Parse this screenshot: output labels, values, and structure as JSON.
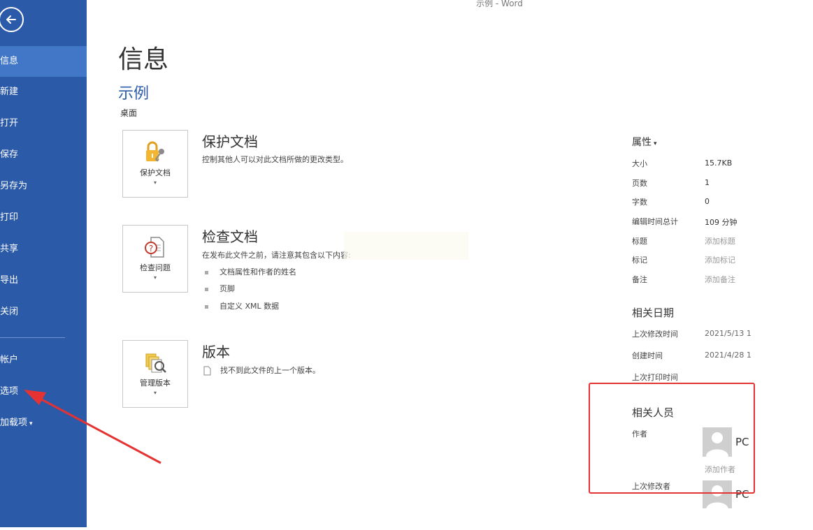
{
  "window": {
    "title": "示例 - Word"
  },
  "sidebar": {
    "items": [
      {
        "label": "信息"
      },
      {
        "label": "新建"
      },
      {
        "label": "打开"
      },
      {
        "label": "保存"
      },
      {
        "label": "另存为"
      },
      {
        "label": "打印"
      },
      {
        "label": "共享"
      },
      {
        "label": "导出"
      },
      {
        "label": "关闭"
      },
      {
        "label": "帐户"
      },
      {
        "label": "选项"
      },
      {
        "label": "加载项"
      }
    ],
    "active_index": 0,
    "accent_color": "#2b5aa8"
  },
  "main": {
    "page_title": "信息",
    "doc_name": "示例",
    "doc_location": "桌面",
    "protect": {
      "button_label": "保护文档",
      "title": "保护文档",
      "description": "控制其他人可以对此文档所做的更改类型。"
    },
    "inspect": {
      "button_label": "检查问题",
      "title": "检查文档",
      "description": "在发布此文件之前，请注意其包含以下内容:",
      "bullets": [
        "文档属性和作者的姓名",
        "页脚",
        "自定义 XML 数据"
      ]
    },
    "versions": {
      "button_label": "管理版本",
      "title": "版本",
      "description": "找不到此文件的上一个版本。"
    }
  },
  "properties": {
    "header": "属性",
    "rows": [
      {
        "label": "大小",
        "value": "15.7KB"
      },
      {
        "label": "页数",
        "value": "1"
      },
      {
        "label": "字数",
        "value": "0"
      },
      {
        "label": "编辑时间总计",
        "value": "109 分钟"
      },
      {
        "label": "标题",
        "value": "添加标题"
      },
      {
        "label": "标记",
        "value": "添加标记"
      },
      {
        "label": "备注",
        "value": "添加备注"
      }
    ],
    "dates": {
      "header": "相关日期",
      "rows": [
        {
          "label": "上次修改时间",
          "value": "2021/5/13 1"
        },
        {
          "label": "创建时间",
          "value": "2021/4/28 1"
        },
        {
          "label": "上次打印时间",
          "value": ""
        }
      ]
    },
    "people": {
      "header": "相关人员",
      "author_label": "作者",
      "author_name": "PC",
      "add_author": "添加作者",
      "last_modified_label": "上次修改者",
      "last_modified_name": "PC"
    }
  },
  "annotation": {
    "highlight_color": "#e53232"
  }
}
